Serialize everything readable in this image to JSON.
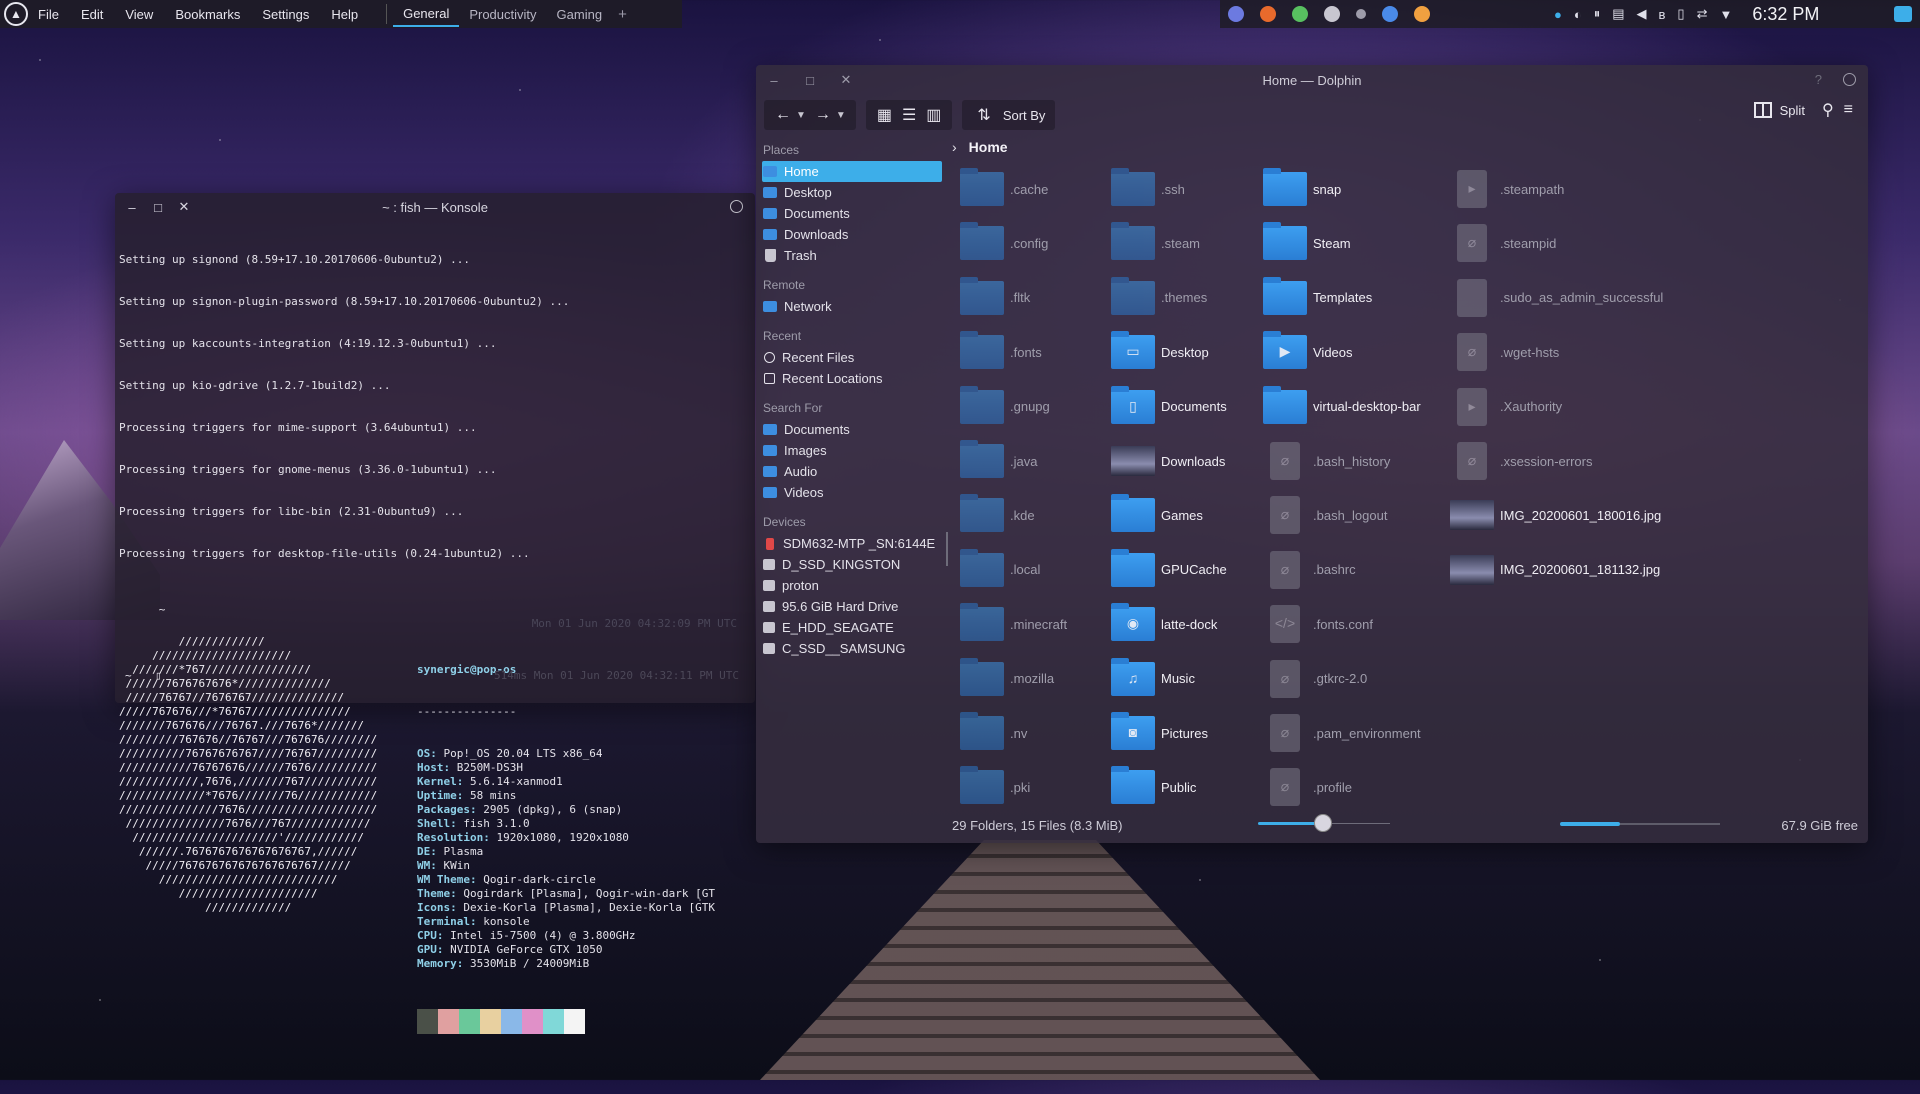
{
  "panel": {
    "menu": [
      "File",
      "Edit",
      "View",
      "Bookmarks",
      "Settings",
      "Help"
    ],
    "desktops": [
      "General",
      "Productivity",
      "Gaming"
    ],
    "active_desktop": 0,
    "add": "+",
    "clock": "6:32 PM",
    "tray_apps": [
      "discord-icon",
      "firefox-icon",
      "android-icon",
      "settings-icon",
      "bluetooth-app-icon",
      "chrome-icon",
      "sublime-icon"
    ],
    "accent": "#3daee9"
  },
  "konsole": {
    "title": "~ : fish — Konsole",
    "lines": [
      "Setting up signond (8.59+17.10.20170606-0ubuntu2) ...",
      "Setting up signon-plugin-password (8.59+17.10.20170606-0ubuntu2) ...",
      "Setting up kaccounts-integration (4:19.12.3-0ubuntu1) ...",
      "Setting up kio-gdrive (1.2.7-1build2) ...",
      "Processing triggers for mime-support (3.64ubuntu1) ...",
      "Processing triggers for gnome-menus (3.36.0-1ubuntu1) ...",
      "Processing triggers for libc-bin (2.31-0ubuntu9) ...",
      "Processing triggers for desktop-file-utils (0.24-1ubuntu2) ..."
    ],
    "prompt1": "~",
    "prompt1_right": "Mon 01 Jun 2020 04:32:09 PM UTC",
    "ascii_art": [
      "         /////////////",
      "     /////////////////////",
      "  ///////*767////////////////",
      " //////7676767676*//////////////",
      " /////76767//7676767//////////////",
      "/////767676///*76767///////////////",
      "///////767676///76767.///7676*///////",
      "/////////767676//76767///767676////////",
      "//////////76767676767////76767/////////",
      "///////////76767676//////7676//////////",
      "////////////,7676,///////767///////////",
      "/////////////*7676///////76////////////",
      "///////////////7676////////////////////",
      " ///////////////7676///767////////////",
      "  //////////////////////'////////////",
      "   //////.7676767676767676767,//////",
      "    /////767676767676767676767/////",
      "      ///////////////////////////",
      "         /////////////////////",
      "             /////////////"
    ],
    "user": "synergic@pop-os",
    "separator": "---------------",
    "info": [
      {
        "key": "OS:",
        "value": " Pop!_OS 20.04 LTS x86_64"
      },
      {
        "key": "Host:",
        "value": " B250M-DS3H"
      },
      {
        "key": "Kernel:",
        "value": " 5.6.14-xanmod1"
      },
      {
        "key": "Uptime:",
        "value": " 58 mins"
      },
      {
        "key": "Packages:",
        "value": " 2905 (dpkg), 6 (snap)"
      },
      {
        "key": "Shell:",
        "value": " fish 3.1.0"
      },
      {
        "key": "Resolution:",
        "value": " 1920x1080, 1920x1080"
      },
      {
        "key": "DE:",
        "value": " Plasma"
      },
      {
        "key": "WM:",
        "value": " KWin"
      },
      {
        "key": "WM Theme:",
        "value": " Qogir-dark-circle"
      },
      {
        "key": "Theme:",
        "value": " Qogirdark [Plasma], Qogir-win-dark [GT"
      },
      {
        "key": "Icons:",
        "value": " Dexie-Korla [Plasma], Dexie-Korla [GTK"
      },
      {
        "key": "Terminal:",
        "value": " konsole"
      },
      {
        "key": "CPU:",
        "value": " Intel i5-7500 (4) @ 3.800GHz"
      },
      {
        "key": "GPU:",
        "value": " NVIDIA GeForce GTX 1050"
      },
      {
        "key": "Memory:",
        "value": " 3530MiB / 24009MiB"
      }
    ],
    "swatches": [
      "#4a5048",
      "#e0a0a0",
      "#6ac89a",
      "#e8d0a0",
      "#8ab8e8",
      "#e090c8",
      "#80d8d8",
      "#f4f4f4"
    ],
    "prompt2": "~",
    "prompt2_right": "514ms  Mon 01 Jun 2020 04:32:11 PM UTC"
  },
  "dolphin": {
    "title": "Home — Dolphin",
    "sort_label": "Sort By",
    "split_label": "Split",
    "places": [
      {
        "section": "Places",
        "items": [
          {
            "label": "Home",
            "icon": "home-icon",
            "selected": true
          },
          {
            "label": "Desktop",
            "icon": "desktop-icon"
          },
          {
            "label": "Documents",
            "icon": "documents-icon"
          },
          {
            "label": "Downloads",
            "icon": "downloads-icon"
          },
          {
            "label": "Trash",
            "icon": "trash-icon"
          }
        ]
      },
      {
        "section": "Remote",
        "items": [
          {
            "label": "Network",
            "icon": "network-icon"
          }
        ]
      },
      {
        "section": "Recent",
        "items": [
          {
            "label": "Recent Files",
            "icon": "clock-icon"
          },
          {
            "label": "Recent Locations",
            "icon": "location-icon"
          }
        ]
      },
      {
        "section": "Search For",
        "items": [
          {
            "label": "Documents",
            "icon": "documents-icon"
          },
          {
            "label": "Images",
            "icon": "images-icon"
          },
          {
            "label": "Audio",
            "icon": "audio-icon"
          },
          {
            "label": "Videos",
            "icon": "videos-icon"
          }
        ]
      },
      {
        "section": "Devices",
        "items": [
          {
            "label": "SDM632-MTP _SN:6144E",
            "icon": "phone-icon"
          },
          {
            "label": "D_SSD_KINGSTON",
            "icon": "drive-icon"
          },
          {
            "label": "proton",
            "icon": "drive-icon"
          },
          {
            "label": "95.6 GiB Hard Drive",
            "icon": "drive-icon"
          },
          {
            "label": "E_HDD_SEAGATE",
            "icon": "drive-icon"
          },
          {
            "label": "C_SSD__SAMSUNG",
            "icon": "drive-icon"
          }
        ]
      }
    ],
    "breadcrumb": "Home",
    "columns": [
      [
        {
          "name": ".cache",
          "type": "folder",
          "hidden": true
        },
        {
          "name": ".config",
          "type": "folder",
          "hidden": true
        },
        {
          "name": ".fltk",
          "type": "folder",
          "hidden": true
        },
        {
          "name": ".fonts",
          "type": "folder",
          "hidden": true
        },
        {
          "name": ".gnupg",
          "type": "folder",
          "hidden": true
        },
        {
          "name": ".java",
          "type": "folder",
          "hidden": true
        },
        {
          "name": ".kde",
          "type": "folder",
          "hidden": true
        },
        {
          "name": ".local",
          "type": "folder",
          "hidden": true
        },
        {
          "name": ".minecraft",
          "type": "folder",
          "hidden": true
        },
        {
          "name": ".mozilla",
          "type": "folder",
          "hidden": true
        },
        {
          "name": ".nv",
          "type": "folder",
          "hidden": true
        },
        {
          "name": ".pki",
          "type": "folder",
          "hidden": true
        }
      ],
      [
        {
          "name": ".ssh",
          "type": "folder",
          "hidden": true
        },
        {
          "name": ".steam",
          "type": "folder",
          "hidden": true
        },
        {
          "name": ".themes",
          "type": "folder",
          "hidden": true
        },
        {
          "name": "Desktop",
          "type": "folder",
          "glyph": "▭"
        },
        {
          "name": "Documents",
          "type": "folder",
          "glyph": "▯"
        },
        {
          "name": "Downloads",
          "type": "image"
        },
        {
          "name": "Games",
          "type": "folder"
        },
        {
          "name": "GPUCache",
          "type": "folder"
        },
        {
          "name": "latte-dock",
          "type": "folder",
          "glyph": "◉"
        },
        {
          "name": "Music",
          "type": "folder",
          "glyph": "♫"
        },
        {
          "name": "Pictures",
          "type": "folder",
          "glyph": "◙"
        },
        {
          "name": "Public",
          "type": "folder"
        }
      ],
      [
        {
          "name": "snap",
          "type": "folder"
        },
        {
          "name": "Steam",
          "type": "folder"
        },
        {
          "name": "Templates",
          "type": "folder"
        },
        {
          "name": "Videos",
          "type": "folder",
          "glyph": "▶"
        },
        {
          "name": "virtual-desktop-bar",
          "type": "folder"
        },
        {
          "name": ".bash_history",
          "type": "file",
          "hidden": true,
          "glyph": "⌀"
        },
        {
          "name": ".bash_logout",
          "type": "file",
          "hidden": true,
          "glyph": "⌀"
        },
        {
          "name": ".bashrc",
          "type": "file",
          "hidden": true,
          "glyph": "⌀"
        },
        {
          "name": ".fonts.conf",
          "type": "file",
          "hidden": true,
          "glyph": "</>"
        },
        {
          "name": ".gtkrc-2.0",
          "type": "file",
          "hidden": true,
          "glyph": "⌀"
        },
        {
          "name": ".pam_environment",
          "type": "file",
          "hidden": true,
          "glyph": "⌀"
        },
        {
          "name": ".profile",
          "type": "file",
          "hidden": true,
          "glyph": "⌀"
        }
      ],
      [
        {
          "name": ".steampath",
          "type": "file",
          "hidden": true,
          "glyph": "▸"
        },
        {
          "name": ".steampid",
          "type": "file",
          "hidden": true,
          "glyph": "⌀"
        },
        {
          "name": ".sudo_as_admin_successful",
          "type": "file",
          "hidden": true,
          "glyph": ""
        },
        {
          "name": ".wget-hsts",
          "type": "file",
          "hidden": true,
          "glyph": "⌀"
        },
        {
          "name": ".Xauthority",
          "type": "file",
          "hidden": true,
          "glyph": "▸"
        },
        {
          "name": ".xsession-errors",
          "type": "file",
          "hidden": true,
          "glyph": "⌀"
        },
        {
          "name": "IMG_20200601_180016.jpg",
          "type": "image"
        },
        {
          "name": "IMG_20200601_181132.jpg",
          "type": "image"
        }
      ]
    ],
    "status": "29 Folders, 15 Files (8.3 MiB)",
    "free": "67.9 GiB free"
  }
}
